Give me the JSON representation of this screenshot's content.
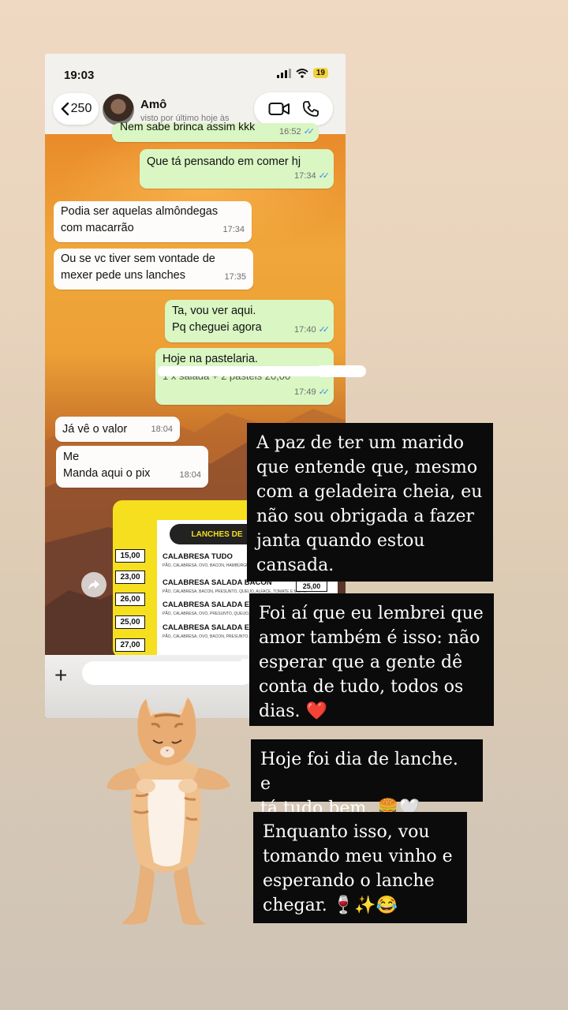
{
  "status_bar": {
    "time": "19:03",
    "battery": "19"
  },
  "header": {
    "back_count": "250",
    "contact_name": "Amô",
    "contact_status": "visto por último hoje às"
  },
  "messages": [
    {
      "text": "Nem sabe brinca assim kkk",
      "time": "16:52",
      "ticks": "✓✓"
    },
    {
      "text": "Que tá pensando em comer hj",
      "time": "17:34",
      "ticks": "✓✓"
    },
    {
      "line1": "Podia ser aquelas almôndegas",
      "line2": "com macarrão",
      "time": "17:34"
    },
    {
      "line1": "Ou se vc tiver sem vontade de",
      "line2": "mexer pede uns lanches",
      "time": "17:35"
    },
    {
      "line1": "Ta, vou ver aqui.",
      "line2": "Pq cheguei agora",
      "time": "17:40",
      "ticks": "✓✓"
    },
    {
      "line1": "Hoje na pastelaria.",
      "line2": "1 x salada + 2 pasteis 20,00",
      "time": "17:49",
      "ticks": "✓✓"
    },
    {
      "text": "Já vê o valor",
      "time": "18:04"
    },
    {
      "line1": "Me",
      "line2": "Manda aqui o pix",
      "time": "18:04"
    }
  ],
  "menu_image": {
    "title": "LANCHES DE",
    "prices": [
      "15,00",
      "23,00",
      "26,00",
      "25,00",
      "27,00"
    ],
    "tag_price": "25,00",
    "items": [
      {
        "name": "CALABRESA TUDO",
        "desc": "PÃO, CALABRESA, OVO, BACON, HAMBÚRGUER, QUEIJO, ALFACE, TOMATE E MILHO"
      },
      {
        "name": "CALABRESA SALADA BACON",
        "desc": "PÃO, CALABRESA, BACON, PRESUNTO, QUEIJO, ALFACE, TOMATE E MILHO"
      },
      {
        "name": "CALABRESA SALADA EGG",
        "desc": "PÃO, CALABRESA, OVO, PRESUNTO, QUEIJO, ALFACE"
      },
      {
        "name": "CALABRESA SALADA EGG BACON",
        "desc": "PÃO, CALABRESA, OVO, BACON, PRESUNTO, QUEIJO"
      }
    ]
  },
  "input_bar": {
    "plus": "+"
  },
  "captions": [
    {
      "lines": [
        "A paz de ter um marido",
        "que entende que, mesmo",
        "com a geladeira cheia, eu",
        "não sou obrigada a fazer",
        "janta quando estou",
        "cansada."
      ]
    },
    {
      "lines": [
        "Foi aí que eu lembrei que",
        "amor também é isso: não",
        "esperar que a gente dê",
        "conta de tudo, todos os",
        "dias. ❤️"
      ]
    },
    {
      "lines": [
        "Hoje foi dia de lanche. e",
        "tá tudo bem. 🍔🤍"
      ]
    },
    {
      "lines": [
        "Enquanto isso, vou",
        "tomando meu vinho e",
        "esperando o lanche",
        "chegar. 🍷✨😂"
      ]
    }
  ],
  "colors": {
    "outgoing_bubble": "#d9f6c3",
    "incoming_bubble": "#fdfcfa",
    "read_ticks": "#3d8fe0",
    "caption_bg": "#0b0b0b",
    "menu_yellow": "#f5df1f"
  }
}
